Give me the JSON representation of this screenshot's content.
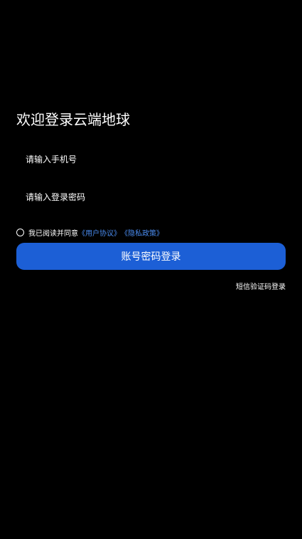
{
  "page": {
    "title": "欢迎登录云端地球"
  },
  "form": {
    "phone_placeholder": "请输入手机号",
    "password_placeholder": "请输入登录密码"
  },
  "agreement": {
    "checked": false,
    "prefix": "我已阅读并同意",
    "user_agreement": "《用户协议》",
    "privacy_policy": "《隐私政策》"
  },
  "actions": {
    "login_label": "账号密码登录",
    "sms_login_label": "短信验证码登录"
  },
  "colors": {
    "background": "#000000",
    "primary": "#1c5fd6",
    "link": "#4a8cf0"
  }
}
